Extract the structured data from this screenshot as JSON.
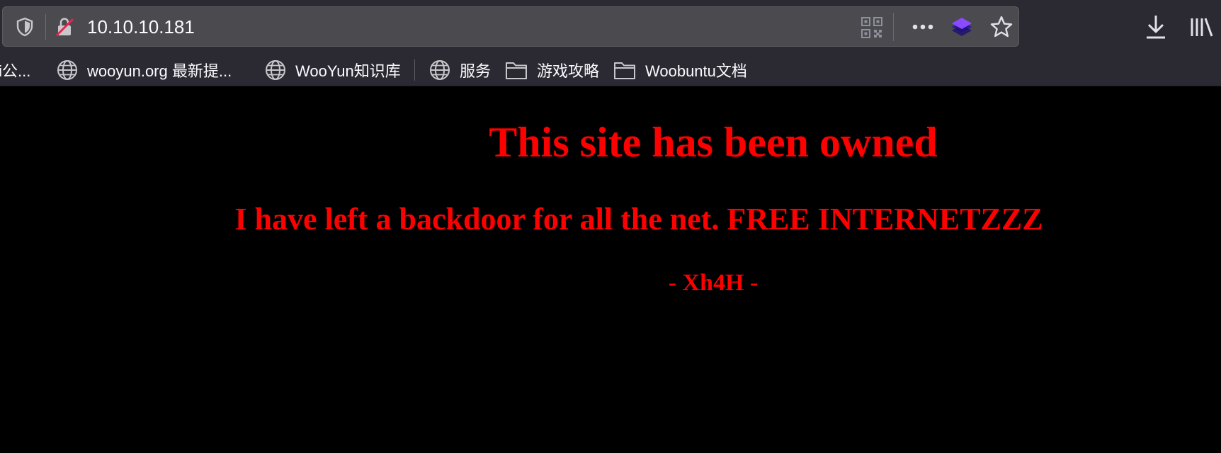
{
  "browser": {
    "url": "10.10.10.181",
    "icons": {
      "tracking_protection": "shield-icon",
      "insecure_connection": "lock-slash-icon",
      "qr_code": "qr-code-icon",
      "page_actions": "more-icon",
      "extension": "layers-extension-icon",
      "bookmark": "star-icon",
      "downloads": "download-icon",
      "library": "library-icon"
    }
  },
  "bookmarks": [
    {
      "label": "fi公...",
      "icon": "none"
    },
    {
      "label": "wooyun.org 最新提...",
      "icon": "globe-icon"
    },
    {
      "label": "WooYun知识库",
      "icon": "globe-icon"
    },
    {
      "label": "服务",
      "icon": "globe-icon"
    },
    {
      "label": "游戏攻略",
      "icon": "folder-icon"
    },
    {
      "label": "Woobuntu文档",
      "icon": "folder-icon"
    }
  ],
  "page": {
    "title": "This site has been owned",
    "message": "I have left a backdoor for all the net. FREE INTERNETZZZ",
    "signature": "- Xh4H -",
    "colors": {
      "background": "#000000",
      "text": "#ff0000"
    }
  }
}
